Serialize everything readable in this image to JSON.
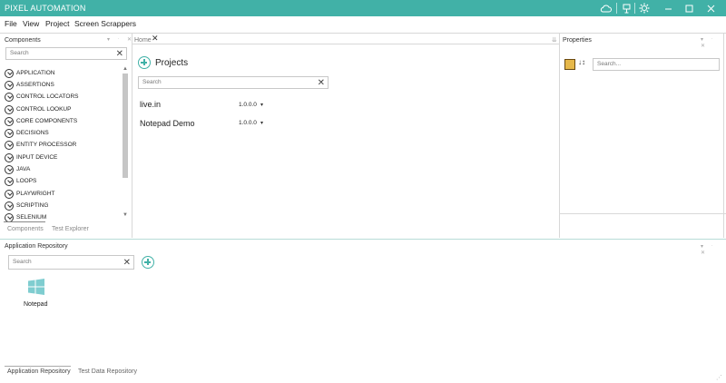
{
  "window": {
    "title": "PIXEL AUTOMATION"
  },
  "menu": [
    "File",
    "View",
    "Project",
    "Screen Scrappers"
  ],
  "components": {
    "title": "Components",
    "search_placeholder": "Search",
    "items": [
      "APPLICATION",
      "ASSERTIONS",
      "CONTROL LOCATORS",
      "CONTROL LOOKUP",
      "CORE COMPONENTS",
      "DECISIONS",
      "ENTITY PROCESSOR",
      "INPUT DEVICE",
      "JAVA",
      "LOOPS",
      "PLAYWRIGHT",
      "SCRIPTING",
      "SELENIUM"
    ],
    "tabs": [
      "Components",
      "Test Explorer"
    ]
  },
  "home": {
    "tab": "Home",
    "heading": "Projects",
    "search_placeholder": "Search",
    "projects": [
      {
        "name": "live.in",
        "version": "1.0.0.0"
      },
      {
        "name": "Notepad Demo",
        "version": "1.0.0.0"
      }
    ]
  },
  "properties": {
    "title": "Properties",
    "search_placeholder": "Search..."
  },
  "repository": {
    "title": "Application Repository",
    "search_placeholder": "Search",
    "apps": [
      {
        "name": "Notepad",
        "icon": "windows-icon"
      }
    ],
    "tabs": [
      "Application Repository",
      "Test Data Repository"
    ]
  },
  "colors": {
    "accent": "#41b1a7"
  }
}
